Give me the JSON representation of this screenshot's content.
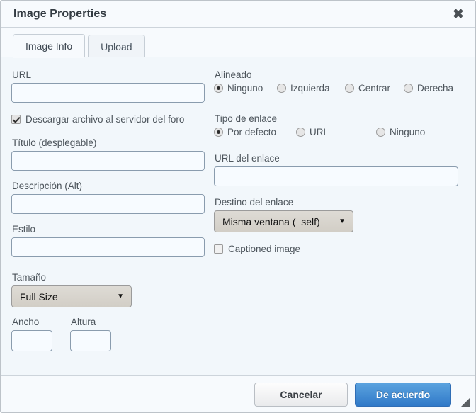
{
  "dialog": {
    "title": "Image Properties",
    "close_icon": "close-icon"
  },
  "tabs": [
    {
      "label": "Image Info",
      "active": true
    },
    {
      "label": "Upload",
      "active": false
    }
  ],
  "left_column": {
    "url": {
      "label": "URL",
      "value": "",
      "placeholder": ""
    },
    "upload_checkbox": {
      "label": "Descargar archivo al servidor del foro",
      "checked": true
    },
    "title_field": {
      "label": "Título (desplegable)",
      "value": "",
      "placeholder": ""
    },
    "description": {
      "label": "Descripción (Alt)",
      "value": "",
      "placeholder": ""
    },
    "style": {
      "label": "Estilo",
      "value": "",
      "placeholder": ""
    },
    "size": {
      "label": "Tamaño",
      "selected": "Full Size",
      "options": [
        "Full Size"
      ],
      "caret_icon": "chevron-down-icon"
    },
    "width": {
      "label": "Ancho",
      "value": "",
      "placeholder": ""
    },
    "height": {
      "label": "Altura",
      "value": "",
      "placeholder": ""
    }
  },
  "right_column": {
    "align": {
      "label": "Alineado",
      "options": [
        {
          "label": "Ninguno",
          "selected": true
        },
        {
          "label": "Izquierda",
          "selected": false
        },
        {
          "label": "Centrar",
          "selected": false
        },
        {
          "label": "Derecha",
          "selected": false
        }
      ]
    },
    "link_type": {
      "label": "Tipo de enlace",
      "options": [
        {
          "label": "Por defecto",
          "selected": true
        },
        {
          "label": "URL",
          "selected": false
        },
        {
          "label": "Ninguno",
          "selected": false
        }
      ]
    },
    "link_url": {
      "label": "URL del enlace",
      "value": "",
      "placeholder": ""
    },
    "link_target": {
      "label": "Destino del enlace",
      "selected": "Misma ventana (_self)",
      "options": [
        "Misma ventana (_self)"
      ],
      "caret_icon": "chevron-down-icon"
    },
    "captioned": {
      "label": "Captioned image",
      "checked": false
    }
  },
  "footer": {
    "cancel_label": "Cancelar",
    "ok_label": "De acuerdo"
  },
  "colors": {
    "body_bg": "#f2f7fb",
    "chrome_bg": "#f7fafd",
    "border": "#cdd4db",
    "accent_blue": "#3079c8",
    "input_border": "#8a9cae",
    "label_text": "#4d555c"
  }
}
